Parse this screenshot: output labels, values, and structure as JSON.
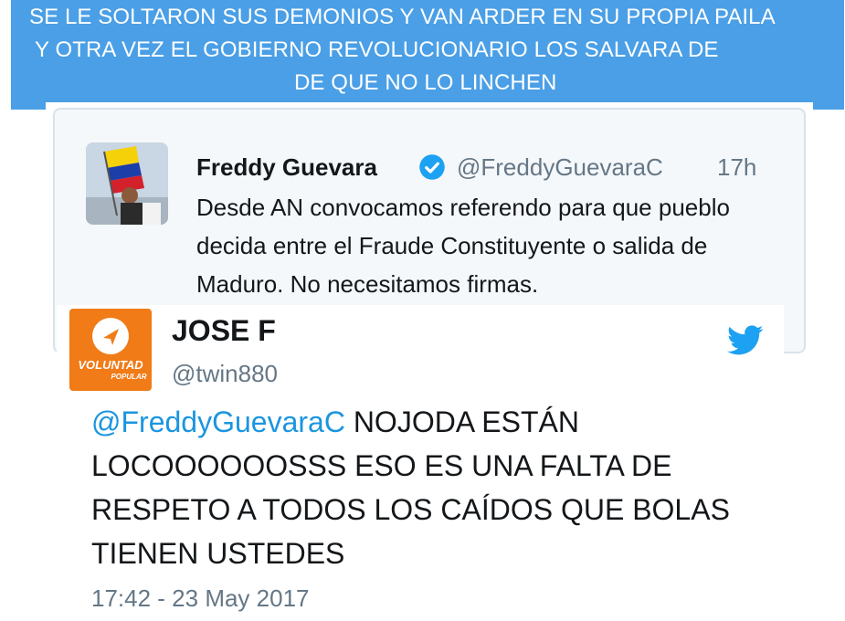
{
  "banner": {
    "line1": "SE LE SOLTARON SUS DEMONIOS Y VAN ARDER EN SU PROPIA PAILA",
    "line2": "Y  OTRA VEZ EL GOBIERNO REVOLUCIONARIO LOS SALVARA DE",
    "line3": "DE QUE NO LO LINCHEN",
    "color": "#4a9fe6"
  },
  "quoted_tweet": {
    "name": "Freddy Guevara",
    "verified_icon": "verified-badge-icon",
    "handle": "@FreddyGuevaraC",
    "time": "17h",
    "text": "Desde AN convocamos referendo para que pueblo decida entre el Fraude Constituyente o salida de Maduro. No necesitamos firmas."
  },
  "tweet": {
    "name": "JOSE F",
    "handle": "@twin880",
    "avatar_text_1": "VOLUNTAD",
    "avatar_text_2": "POPULAR",
    "mention": "@FreddyGuevaraC",
    "text": " NOJODA ESTÁN LOCOOOOOOSSS ESO ES UNA FALTA DE RESPETO A TODOS LOS CAÍDOS QUE BOLAS TIENEN USTEDES",
    "timestamp": "17:42 - 23 May 2017",
    "brand_icon": "twitter-bird-icon",
    "link_color": "#1b95e0",
    "avatar_color": "#f07b17"
  }
}
